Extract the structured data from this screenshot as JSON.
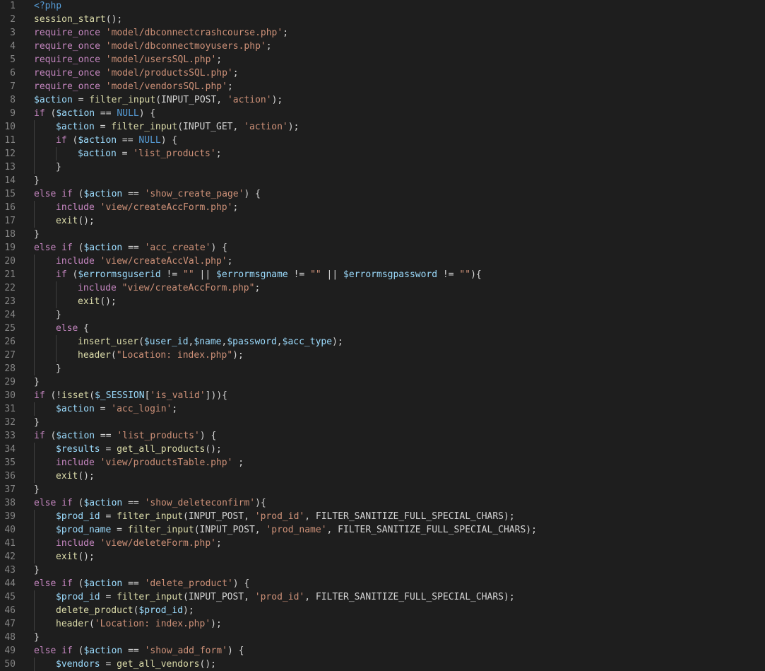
{
  "editor": {
    "colors": {
      "background": "#1e1e1e",
      "line_number": "#858585",
      "default": "#d4d4d4",
      "keyword": "#c586c0",
      "function": "#dcdcaa",
      "variable": "#9cdcfe",
      "string": "#ce9178",
      "constant": "#569cd6",
      "tag": "#569cd6"
    },
    "lines": [
      {
        "n": "1",
        "indent": 0,
        "tokens": [
          [
            "<?php",
            "tag"
          ]
        ]
      },
      {
        "n": "2",
        "indent": 0,
        "tokens": [
          [
            "session_start",
            "function"
          ],
          [
            "();",
            "default"
          ]
        ]
      },
      {
        "n": "3",
        "indent": 0,
        "tokens": [
          [
            "require_once",
            "keyword"
          ],
          [
            " ",
            "default"
          ],
          [
            "'model/dbconnectcrashcourse.php'",
            "string"
          ],
          [
            ";",
            "default"
          ]
        ]
      },
      {
        "n": "4",
        "indent": 0,
        "tokens": [
          [
            "require_once",
            "keyword"
          ],
          [
            " ",
            "default"
          ],
          [
            "'model/dbconnectmoyusers.php'",
            "string"
          ],
          [
            ";",
            "default"
          ]
        ]
      },
      {
        "n": "5",
        "indent": 0,
        "tokens": [
          [
            "require_once",
            "keyword"
          ],
          [
            " ",
            "default"
          ],
          [
            "'model/usersSQL.php'",
            "string"
          ],
          [
            ";",
            "default"
          ]
        ]
      },
      {
        "n": "6",
        "indent": 0,
        "tokens": [
          [
            "require_once",
            "keyword"
          ],
          [
            " ",
            "default"
          ],
          [
            "'model/productsSQL.php'",
            "string"
          ],
          [
            ";",
            "default"
          ]
        ]
      },
      {
        "n": "7",
        "indent": 0,
        "tokens": [
          [
            "require_once",
            "keyword"
          ],
          [
            " ",
            "default"
          ],
          [
            "'model/vendorsSQL.php'",
            "string"
          ],
          [
            ";",
            "default"
          ]
        ]
      },
      {
        "n": "8",
        "indent": 0,
        "tokens": [
          [
            "$action",
            "variable"
          ],
          [
            " = ",
            "default"
          ],
          [
            "filter_input",
            "function"
          ],
          [
            "(INPUT_POST, ",
            "default"
          ],
          [
            "'action'",
            "string"
          ],
          [
            ");",
            "default"
          ]
        ]
      },
      {
        "n": "9",
        "indent": 0,
        "tokens": [
          [
            "if",
            "keyword"
          ],
          [
            " (",
            "default"
          ],
          [
            "$action",
            "variable"
          ],
          [
            " == ",
            "default"
          ],
          [
            "NULL",
            "constant"
          ],
          [
            ") {",
            "default"
          ]
        ]
      },
      {
        "n": "10",
        "indent": 1,
        "tokens": [
          [
            "$action",
            "variable"
          ],
          [
            " = ",
            "default"
          ],
          [
            "filter_input",
            "function"
          ],
          [
            "(INPUT_GET, ",
            "default"
          ],
          [
            "'action'",
            "string"
          ],
          [
            ");",
            "default"
          ]
        ]
      },
      {
        "n": "11",
        "indent": 1,
        "tokens": [
          [
            "if",
            "keyword"
          ],
          [
            " (",
            "default"
          ],
          [
            "$action",
            "variable"
          ],
          [
            " == ",
            "default"
          ],
          [
            "NULL",
            "constant"
          ],
          [
            ") {",
            "default"
          ]
        ]
      },
      {
        "n": "12",
        "indent": 2,
        "tokens": [
          [
            "$action",
            "variable"
          ],
          [
            " = ",
            "default"
          ],
          [
            "'list_products'",
            "string"
          ],
          [
            ";",
            "default"
          ]
        ]
      },
      {
        "n": "13",
        "indent": 1,
        "tokens": [
          [
            "}",
            "default"
          ]
        ]
      },
      {
        "n": "14",
        "indent": 0,
        "tokens": [
          [
            "}",
            "default"
          ]
        ]
      },
      {
        "n": "15",
        "indent": 0,
        "tokens": [
          [
            "else",
            "keyword"
          ],
          [
            " ",
            "default"
          ],
          [
            "if",
            "keyword"
          ],
          [
            " (",
            "default"
          ],
          [
            "$action",
            "variable"
          ],
          [
            " == ",
            "default"
          ],
          [
            "'show_create_page'",
            "string"
          ],
          [
            ") {",
            "default"
          ]
        ]
      },
      {
        "n": "16",
        "indent": 1,
        "tokens": [
          [
            "include",
            "keyword"
          ],
          [
            " ",
            "default"
          ],
          [
            "'view/createAccForm.php'",
            "string"
          ],
          [
            ";",
            "default"
          ]
        ]
      },
      {
        "n": "17",
        "indent": 1,
        "tokens": [
          [
            "exit",
            "function"
          ],
          [
            "();",
            "default"
          ]
        ]
      },
      {
        "n": "18",
        "indent": 0,
        "tokens": [
          [
            "}",
            "default"
          ]
        ]
      },
      {
        "n": "19",
        "indent": 0,
        "tokens": [
          [
            "else",
            "keyword"
          ],
          [
            " ",
            "default"
          ],
          [
            "if",
            "keyword"
          ],
          [
            " (",
            "default"
          ],
          [
            "$action",
            "variable"
          ],
          [
            " == ",
            "default"
          ],
          [
            "'acc_create'",
            "string"
          ],
          [
            ") {",
            "default"
          ]
        ]
      },
      {
        "n": "20",
        "indent": 1,
        "tokens": [
          [
            "include",
            "keyword"
          ],
          [
            " ",
            "default"
          ],
          [
            "'view/createAccVal.php'",
            "string"
          ],
          [
            ";",
            "default"
          ]
        ]
      },
      {
        "n": "21",
        "indent": 1,
        "tokens": [
          [
            "if",
            "keyword"
          ],
          [
            " (",
            "default"
          ],
          [
            "$errormsguserid",
            "variable"
          ],
          [
            " != ",
            "default"
          ],
          [
            "\"\"",
            "string"
          ],
          [
            " || ",
            "default"
          ],
          [
            "$errormsgname",
            "variable"
          ],
          [
            " != ",
            "default"
          ],
          [
            "\"\"",
            "string"
          ],
          [
            " || ",
            "default"
          ],
          [
            "$errormsgpassword",
            "variable"
          ],
          [
            " != ",
            "default"
          ],
          [
            "\"\"",
            "string"
          ],
          [
            "){",
            "default"
          ]
        ]
      },
      {
        "n": "22",
        "indent": 2,
        "tokens": [
          [
            "include",
            "keyword"
          ],
          [
            " ",
            "default"
          ],
          [
            "\"view/createAccForm.php\"",
            "string"
          ],
          [
            ";",
            "default"
          ]
        ]
      },
      {
        "n": "23",
        "indent": 2,
        "tokens": [
          [
            "exit",
            "function"
          ],
          [
            "();",
            "default"
          ]
        ]
      },
      {
        "n": "24",
        "indent": 1,
        "tokens": [
          [
            "}",
            "default"
          ]
        ]
      },
      {
        "n": "25",
        "indent": 1,
        "tokens": [
          [
            "else",
            "keyword"
          ],
          [
            " {",
            "default"
          ]
        ]
      },
      {
        "n": "26",
        "indent": 2,
        "tokens": [
          [
            "insert_user",
            "function"
          ],
          [
            "(",
            "default"
          ],
          [
            "$user_id",
            "variable"
          ],
          [
            ",",
            "default"
          ],
          [
            "$name",
            "variable"
          ],
          [
            ",",
            "default"
          ],
          [
            "$password",
            "variable"
          ],
          [
            ",",
            "default"
          ],
          [
            "$acc_type",
            "variable"
          ],
          [
            ");",
            "default"
          ]
        ]
      },
      {
        "n": "27",
        "indent": 2,
        "tokens": [
          [
            "header",
            "function"
          ],
          [
            "(",
            "default"
          ],
          [
            "\"Location: index.php\"",
            "string"
          ],
          [
            ");",
            "default"
          ]
        ]
      },
      {
        "n": "28",
        "indent": 1,
        "tokens": [
          [
            "}",
            "default"
          ]
        ]
      },
      {
        "n": "29",
        "indent": 0,
        "tokens": [
          [
            "}",
            "default"
          ]
        ]
      },
      {
        "n": "30",
        "indent": 0,
        "tokens": [
          [
            "if",
            "keyword"
          ],
          [
            " (!",
            "default"
          ],
          [
            "isset",
            "function"
          ],
          [
            "(",
            "default"
          ],
          [
            "$_SESSION",
            "variable"
          ],
          [
            "[",
            "default"
          ],
          [
            "'is_valid'",
            "string"
          ],
          [
            "])){",
            "default"
          ]
        ]
      },
      {
        "n": "31",
        "indent": 1,
        "tokens": [
          [
            "$action",
            "variable"
          ],
          [
            " = ",
            "default"
          ],
          [
            "'acc_login'",
            "string"
          ],
          [
            ";",
            "default"
          ]
        ]
      },
      {
        "n": "32",
        "indent": 0,
        "tokens": [
          [
            "}",
            "default"
          ]
        ]
      },
      {
        "n": "33",
        "indent": 0,
        "tokens": [
          [
            "if",
            "keyword"
          ],
          [
            " (",
            "default"
          ],
          [
            "$action",
            "variable"
          ],
          [
            " == ",
            "default"
          ],
          [
            "'list_products'",
            "string"
          ],
          [
            ") {",
            "default"
          ]
        ]
      },
      {
        "n": "34",
        "indent": 1,
        "tokens": [
          [
            "$results",
            "variable"
          ],
          [
            " = ",
            "default"
          ],
          [
            "get_all_products",
            "function"
          ],
          [
            "();",
            "default"
          ]
        ]
      },
      {
        "n": "35",
        "indent": 1,
        "tokens": [
          [
            "include",
            "keyword"
          ],
          [
            " ",
            "default"
          ],
          [
            "'view/productsTable.php'",
            "string"
          ],
          [
            " ;",
            "default"
          ]
        ]
      },
      {
        "n": "36",
        "indent": 1,
        "tokens": [
          [
            "exit",
            "function"
          ],
          [
            "();",
            "default"
          ]
        ]
      },
      {
        "n": "37",
        "indent": 0,
        "tokens": [
          [
            "}",
            "default"
          ]
        ]
      },
      {
        "n": "38",
        "indent": 0,
        "tokens": [
          [
            "else",
            "keyword"
          ],
          [
            " ",
            "default"
          ],
          [
            "if",
            "keyword"
          ],
          [
            " (",
            "default"
          ],
          [
            "$action",
            "variable"
          ],
          [
            " == ",
            "default"
          ],
          [
            "'show_deleteconfirm'",
            "string"
          ],
          [
            "){",
            "default"
          ]
        ]
      },
      {
        "n": "39",
        "indent": 1,
        "tokens": [
          [
            "$prod_id",
            "variable"
          ],
          [
            " = ",
            "default"
          ],
          [
            "filter_input",
            "function"
          ],
          [
            "(INPUT_POST, ",
            "default"
          ],
          [
            "'prod_id'",
            "string"
          ],
          [
            ", FILTER_SANITIZE_FULL_SPECIAL_CHARS);",
            "default"
          ]
        ]
      },
      {
        "n": "40",
        "indent": 1,
        "tokens": [
          [
            "$prod_name",
            "variable"
          ],
          [
            " = ",
            "default"
          ],
          [
            "filter_input",
            "function"
          ],
          [
            "(INPUT_POST, ",
            "default"
          ],
          [
            "'prod_name'",
            "string"
          ],
          [
            ", FILTER_SANITIZE_FULL_SPECIAL_CHARS);",
            "default"
          ]
        ]
      },
      {
        "n": "41",
        "indent": 1,
        "tokens": [
          [
            "include",
            "keyword"
          ],
          [
            " ",
            "default"
          ],
          [
            "'view/deleteForm.php'",
            "string"
          ],
          [
            ";",
            "default"
          ]
        ]
      },
      {
        "n": "42",
        "indent": 1,
        "tokens": [
          [
            "exit",
            "function"
          ],
          [
            "();",
            "default"
          ]
        ]
      },
      {
        "n": "43",
        "indent": 0,
        "tokens": [
          [
            "}",
            "default"
          ]
        ]
      },
      {
        "n": "44",
        "indent": 0,
        "tokens": [
          [
            "else",
            "keyword"
          ],
          [
            " ",
            "default"
          ],
          [
            "if",
            "keyword"
          ],
          [
            " (",
            "default"
          ],
          [
            "$action",
            "variable"
          ],
          [
            " == ",
            "default"
          ],
          [
            "'delete_product'",
            "string"
          ],
          [
            ") {",
            "default"
          ]
        ]
      },
      {
        "n": "45",
        "indent": 1,
        "tokens": [
          [
            "$prod_id",
            "variable"
          ],
          [
            " = ",
            "default"
          ],
          [
            "filter_input",
            "function"
          ],
          [
            "(INPUT_POST, ",
            "default"
          ],
          [
            "'prod_id'",
            "string"
          ],
          [
            ", FILTER_SANITIZE_FULL_SPECIAL_CHARS);",
            "default"
          ]
        ]
      },
      {
        "n": "46",
        "indent": 1,
        "tokens": [
          [
            "delete_product",
            "function"
          ],
          [
            "(",
            "default"
          ],
          [
            "$prod_id",
            "variable"
          ],
          [
            ");",
            "default"
          ]
        ]
      },
      {
        "n": "47",
        "indent": 1,
        "tokens": [
          [
            "header",
            "function"
          ],
          [
            "(",
            "default"
          ],
          [
            "'Location: index.php'",
            "string"
          ],
          [
            ");",
            "default"
          ]
        ]
      },
      {
        "n": "48",
        "indent": 0,
        "tokens": [
          [
            "}",
            "default"
          ]
        ]
      },
      {
        "n": "49",
        "indent": 0,
        "tokens": [
          [
            "else",
            "keyword"
          ],
          [
            " ",
            "default"
          ],
          [
            "if",
            "keyword"
          ],
          [
            " (",
            "default"
          ],
          [
            "$action",
            "variable"
          ],
          [
            " == ",
            "default"
          ],
          [
            "'show_add_form'",
            "string"
          ],
          [
            ") {",
            "default"
          ]
        ]
      },
      {
        "n": "50",
        "indent": 1,
        "tokens": [
          [
            "$vendors",
            "variable"
          ],
          [
            " = ",
            "default"
          ],
          [
            "get_all_vendors",
            "function"
          ],
          [
            "();",
            "default"
          ]
        ]
      }
    ]
  }
}
